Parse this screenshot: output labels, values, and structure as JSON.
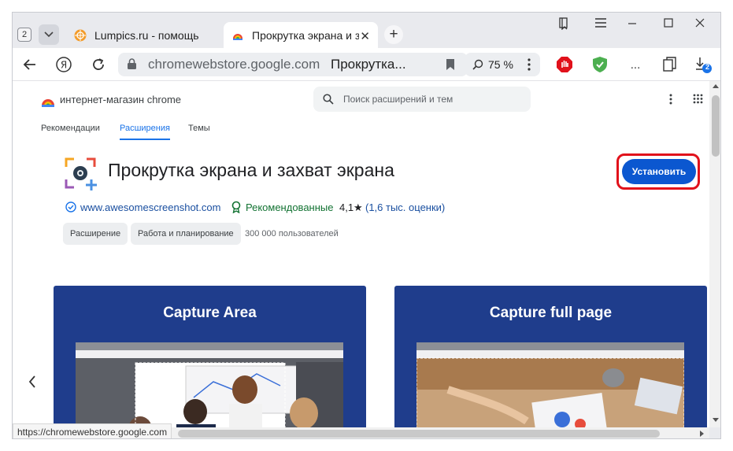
{
  "tabs": {
    "count": "2",
    "items": [
      {
        "title": "Lumpics.ru - помощь с ком"
      },
      {
        "title": "Прокрутка экрана и за"
      }
    ]
  },
  "toolbar": {
    "domain": "chromewebstore.google.com",
    "page_title": "Прокрутка...",
    "zoom": "75 %",
    "downloads_badge": "2",
    "more": "..."
  },
  "store": {
    "name": "интернет-магазин chrome",
    "search_placeholder": "Поиск расширений и тем",
    "nav": [
      "Рекомендации",
      "Расширения",
      "Темы"
    ]
  },
  "extension": {
    "title": "Прокрутка экрана и захват экрана",
    "install_label": "Установить",
    "website": "www.awesomescreenshot.com",
    "featured": "Рекомендованные",
    "rating": "4,1",
    "star": "★",
    "ratings_count": "(1,6 тыс. оценки)",
    "chips": [
      "Расширение",
      "Работа и планирование"
    ],
    "users": "300 000 пользователей"
  },
  "screenshots": [
    {
      "title": "Capture Area"
    },
    {
      "title": "Capture full page"
    }
  ],
  "status_url": "https://chromewebstore.google.com",
  "colors": {
    "accent": "#1a73e8",
    "install": "#0b57d0",
    "highlight": "#e1111b",
    "card": "#1f3d8c",
    "featured": "#137333"
  }
}
